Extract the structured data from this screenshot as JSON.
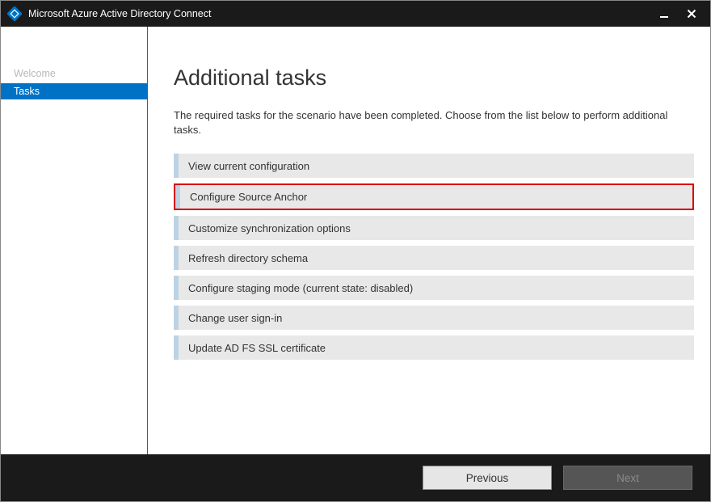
{
  "window": {
    "title": "Microsoft Azure Active Directory Connect"
  },
  "sidebar": {
    "items": [
      {
        "label": "Welcome",
        "active": false
      },
      {
        "label": "Tasks",
        "active": true
      }
    ]
  },
  "main": {
    "heading": "Additional tasks",
    "intro": "The required tasks for the scenario have been completed. Choose from the list below to perform additional tasks.",
    "tasks": [
      {
        "label": "View current configuration",
        "highlighted": false
      },
      {
        "label": "Configure Source Anchor",
        "highlighted": true
      },
      {
        "label": "Customize synchronization options",
        "highlighted": false
      },
      {
        "label": "Refresh directory schema",
        "highlighted": false
      },
      {
        "label": "Configure staging mode (current state: disabled)",
        "highlighted": false
      },
      {
        "label": "Change user sign-in",
        "highlighted": false
      },
      {
        "label": "Update AD FS SSL certificate",
        "highlighted": false
      }
    ]
  },
  "footer": {
    "previous": "Previous",
    "next": "Next"
  }
}
